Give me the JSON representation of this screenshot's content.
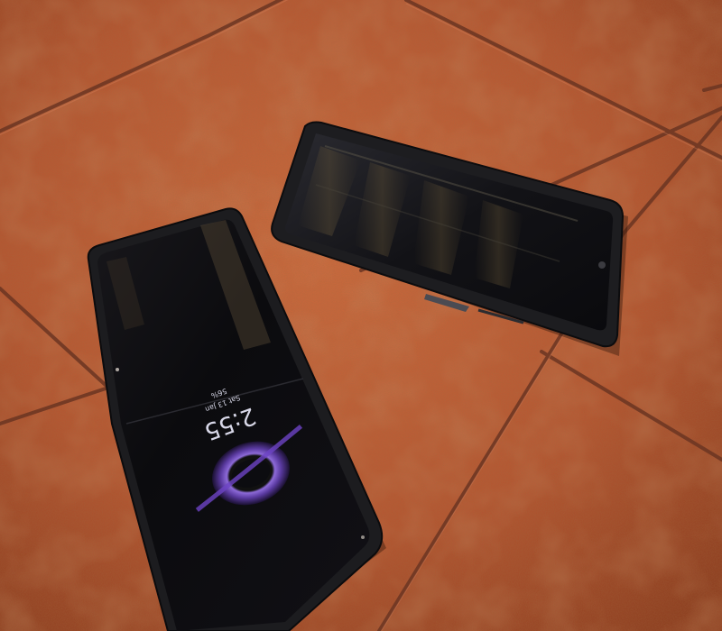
{
  "scene": {
    "description_free": true,
    "floor_colors": {
      "tile_base": "#b85a34",
      "tile_dark": "#8e3f22",
      "tile_light": "#d0764a",
      "grout": "#6e3a26"
    },
    "phone_case_color": "#1c1c1f",
    "screen_color": "#0c0c10"
  },
  "phone_left": {
    "lock_screen": {
      "time": "2:55",
      "date": "Sat 13 Jan",
      "battery": "56%"
    },
    "wallpaper_accent": "#7b4cc9"
  }
}
